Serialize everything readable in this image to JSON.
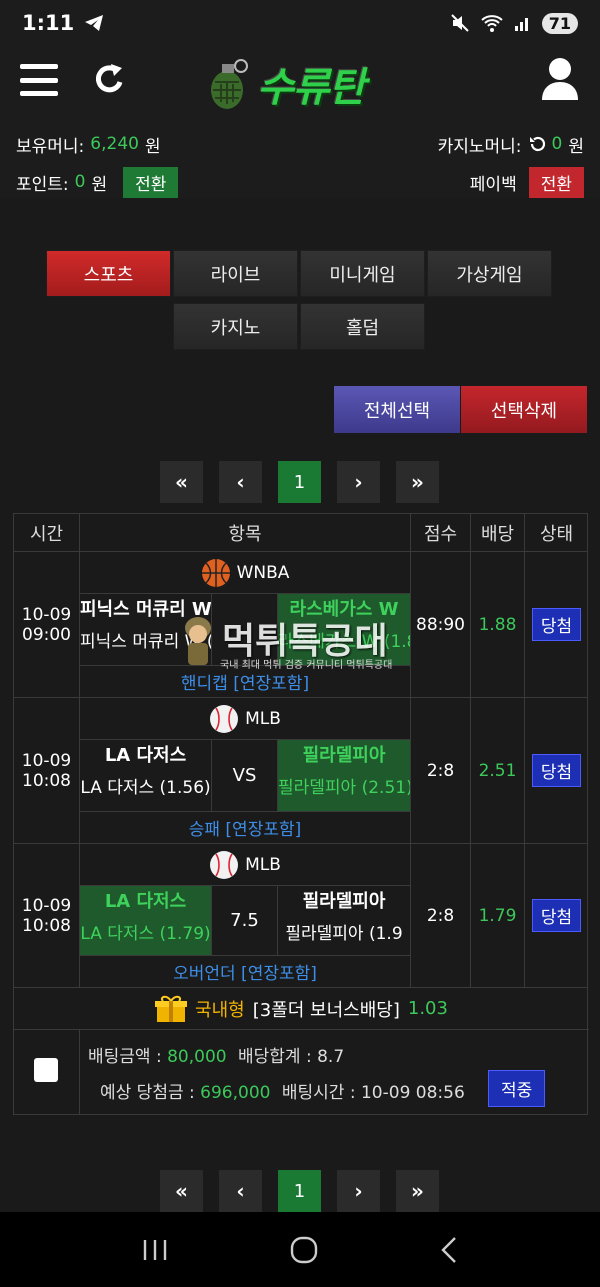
{
  "status_bar": {
    "time": "1:11",
    "battery": "71",
    "icons": [
      "telegram-icon",
      "mute-icon",
      "wifi-icon",
      "signal-icon"
    ]
  },
  "header": {
    "logo_text": "수류탄",
    "icons": [
      "menu-icon",
      "refresh-icon",
      "grenade-logo",
      "user-icon"
    ]
  },
  "wallet": {
    "holding_label": "보유머니:",
    "holding_value": "6,240",
    "holding_unit": "원",
    "casino_label": "카지노머니:",
    "casino_value": "0",
    "casino_unit": "원",
    "point_label": "포인트:",
    "point_value": "0",
    "point_unit": "원",
    "convert_label": "전환",
    "payback_label": "페이백",
    "payback_convert_label": "전환"
  },
  "tabs": [
    "스포츠",
    "라이브",
    "미니게임",
    "가상게임",
    "카지노",
    "홀덤"
  ],
  "selection": {
    "select_all": "전체선택",
    "delete_selected": "선택삭제"
  },
  "pager": {
    "first": "«",
    "prev": "‹",
    "current": "1",
    "next": "›",
    "last": "»"
  },
  "table": {
    "headers": [
      "시간",
      "항목",
      "점수",
      "배당",
      "상태"
    ],
    "rows": [
      {
        "date": "10-09",
        "time": "09:00",
        "league": "WNBA",
        "sport_icon": "basketball-icon",
        "home_name": "피닉스 머큐리 W",
        "home_odd": "피닉스 머큐리 W (1.88)",
        "middle": "",
        "away_name": "라스베가스 W",
        "away_odd": "라스베가스 W (1.88)",
        "winner": "away",
        "bet_type": "핸디캡 [연장포함]",
        "score": "88:90",
        "odds": "1.88",
        "status": "당첨"
      },
      {
        "date": "10-09",
        "time": "10:08",
        "league": "MLB",
        "sport_icon": "baseball-icon",
        "home_name": "LA 다저스",
        "home_odd": "LA 다저스 (1.56)",
        "middle": "VS",
        "away_name": "필라델피아",
        "away_odd": "필라델피아 (2.51)",
        "winner": "away",
        "bet_type": "승패 [연장포함]",
        "score": "2:8",
        "odds": "2.51",
        "status": "당첨"
      },
      {
        "date": "10-09",
        "time": "10:08",
        "league": "MLB",
        "sport_icon": "baseball-icon",
        "home_name": "LA 다저스",
        "home_odd": "LA 다저스 (1.79)",
        "middle": "7.5",
        "away_name": "필라델피아",
        "away_odd": "필라델피아 (1.9",
        "winner": "home",
        "bet_type": "오버언더 [연장포함]",
        "score": "2:8",
        "odds": "1.79",
        "status": "당첨"
      }
    ]
  },
  "bonus": {
    "type": "국내형",
    "desc": "[3폴더 보너스배당]",
    "value": "1.03"
  },
  "summary": {
    "bet_amount_label": "배팅금액 :",
    "bet_amount": "80,000",
    "odds_total_label": "배당합계 :",
    "odds_total": "8.7",
    "expected_label": "예상 당첨금 :",
    "expected": "696,000",
    "bet_time_label": "배팅시간 :",
    "bet_time": "10-09 08:56",
    "result": "적중"
  },
  "watermark": {
    "title": "먹튀특공대",
    "subtitle": "국내 최대 먹튀 검증 커뮤니티 먹튀특공대"
  },
  "colors": {
    "win_green": "#3ed15c",
    "active_red": "#c1272d",
    "status_blue": "#1c2fb5"
  }
}
